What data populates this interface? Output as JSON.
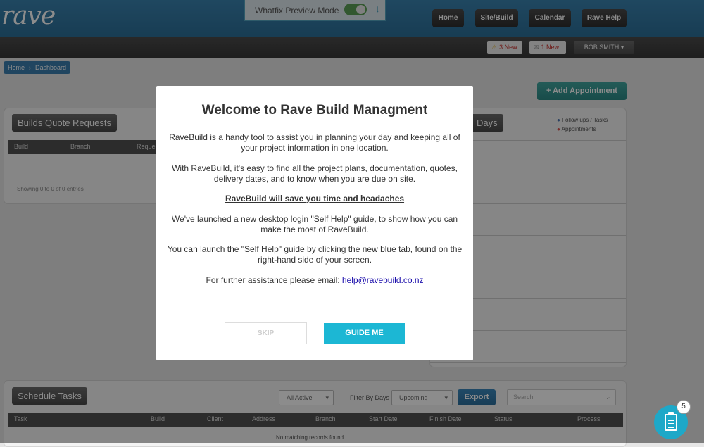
{
  "header": {
    "logo": "rave",
    "whatfix_label": "Whatfix Preview Mode",
    "nav": [
      "Home",
      "Site/Build",
      "Calendar",
      "Rave Help"
    ]
  },
  "subbar": {
    "alerts": "3 New",
    "messages": "1 New",
    "user": "BOB SMITH ▾"
  },
  "breadcrumb": [
    "Home",
    "Dashboard"
  ],
  "add_appointment": "Add Appointment",
  "quotes_panel": {
    "title": "Builds Quote Requests",
    "columns": [
      "Build",
      "Branch",
      "Reque"
    ],
    "footer": "Showing 0 to 0 of 0 entries"
  },
  "calendar_panel": {
    "title": "Days",
    "legend": [
      "Follow ups / Tasks",
      "Appointments"
    ],
    "legend_colors": [
      "#4a74b0",
      "#d9534f"
    ]
  },
  "tasks_panel": {
    "title": "Schedule Tasks",
    "status_filter": "All Active",
    "filter_label": "Filter By Days",
    "days_filter": "Upcoming",
    "export": "Export",
    "search_placeholder": "Search",
    "columns": [
      "Task",
      "Build",
      "Client",
      "Address",
      "Branch",
      "Start Date",
      "Finish Date",
      "Status",
      "Process"
    ],
    "empty": "No matching records found"
  },
  "modal": {
    "title": "Welcome to Rave Build Managment",
    "p1": "RaveBuild is a handy tool to assist you in planning your day and keeping all of your project information in one location.",
    "p2": "With RaveBuild, it's easy to find all the project plans, documentation, quotes, delivery dates, and to know when you are due on site.",
    "highlight": "RaveBuild will save you time and headaches",
    "p3": "We've launched a new desktop login \"Self Help\" guide, to show how you can make the most of RaveBuild.",
    "p4": "You can launch the \"Self Help\" guide by clicking the new blue tab, found on the right-hand side of your screen.",
    "p5_prefix": "For further assistance please email:",
    "email": "help@ravebuild.co.nz",
    "skip": "SKIP",
    "guide": "GUIDE ME"
  },
  "help_widget": {
    "count": "5"
  }
}
